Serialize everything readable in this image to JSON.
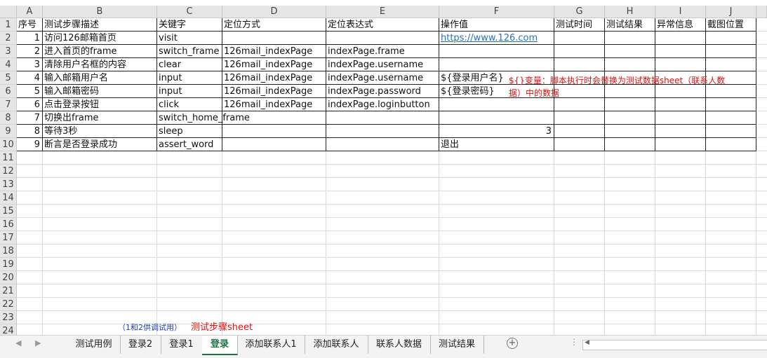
{
  "columns": [
    "A",
    "B",
    "C",
    "D",
    "E",
    "F",
    "G",
    "H",
    "I",
    "J"
  ],
  "row_numbers": [
    "1",
    "2",
    "3",
    "4",
    "5",
    "6",
    "7",
    "8",
    "9",
    "10",
    "11",
    "12",
    "13",
    "14",
    "15",
    "16",
    "17",
    "18",
    "19",
    "20",
    "21",
    "22",
    "23",
    "24"
  ],
  "header_row": [
    "序号",
    "测试步骤描述",
    "关键字",
    "定位方式",
    "定位表达式",
    "操作值",
    "测试时间",
    "测试结果",
    "异常信息",
    "截图位置"
  ],
  "rows": [
    [
      "1",
      "访问126邮箱首页",
      "visit",
      "",
      "",
      "https://www.126.com",
      "",
      "",
      "",
      ""
    ],
    [
      "2",
      "进入首页的frame",
      "switch_frame",
      "126mail_indexPage",
      "indexPage.frame",
      "",
      "",
      "",
      "",
      ""
    ],
    [
      "3",
      "清除用户名框的内容",
      "clear",
      "126mail_indexPage",
      "indexPage.username",
      "",
      "",
      "",
      "",
      ""
    ],
    [
      "4",
      "输入邮箱用户名",
      "input",
      "126mail_indexPage",
      "indexPage.username",
      "${登录用户名}",
      "",
      "",
      "",
      ""
    ],
    [
      "5",
      "输入邮箱密码",
      "input",
      "126mail_indexPage",
      "indexPage.password",
      "${登录密码}",
      "",
      "",
      "",
      ""
    ],
    [
      "6",
      "点击登录按钮",
      "click",
      "126mail_indexPage",
      "indexPage.loginbutton",
      "",
      "",
      "",
      "",
      ""
    ],
    [
      "7",
      "切换出frame",
      "switch_home_frame",
      "",
      "",
      "",
      "",
      "",
      "",
      ""
    ],
    [
      "8",
      "等待3秒",
      "sleep",
      "",
      "",
      "3",
      "",
      "",
      "",
      ""
    ],
    [
      "9",
      "断言是否登录成功",
      "assert_word",
      "",
      "",
      "退出",
      "",
      "",
      "",
      ""
    ]
  ],
  "annotations": {
    "variable_note_line1": "${}变量：脚本执行时会替换为测试数据sheet（联系人数",
    "variable_note_line2": "据）中的数据",
    "debug_note": "（1和2供调试用）",
    "sheet_note": "测试步骤sheet"
  },
  "sheet_tabs": [
    "测试用例",
    "登录2",
    "登录1",
    "登录",
    "添加联系人1",
    "添加联系人",
    "联系人数据",
    "测试结果"
  ],
  "active_tab": "登录",
  "colors": {
    "accent": "#1e7145",
    "annotation": "#e01010",
    "link": "#2a6fbf"
  }
}
